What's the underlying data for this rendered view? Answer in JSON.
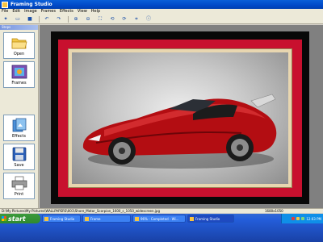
{
  "window": {
    "title": "Framing Studio"
  },
  "menu": [
    "File",
    "Edit",
    "Image",
    "Frames",
    "Effects",
    "View",
    "Help"
  ],
  "toolbar": {
    "buttons": [
      {
        "icon": "new-icon",
        "glyph": "✦"
      },
      {
        "icon": "folder-icon",
        "glyph": "▭"
      },
      {
        "icon": "save-icon",
        "glyph": "■"
      },
      {
        "icon": "undo-icon",
        "glyph": "↶"
      },
      {
        "icon": "redo-icon",
        "glyph": "↷"
      },
      {
        "icon": "zoom-in-icon",
        "glyph": "⊕"
      },
      {
        "icon": "zoom-out-icon",
        "glyph": "⊖"
      },
      {
        "icon": "fit-icon",
        "glyph": "⛶"
      },
      {
        "icon": "rotate-left-icon",
        "glyph": "⟲"
      },
      {
        "icon": "rotate-right-icon",
        "glyph": "⟳"
      },
      {
        "icon": "crop-icon",
        "glyph": "⌗"
      },
      {
        "icon": "info-icon",
        "glyph": "ⓘ"
      }
    ]
  },
  "sidebar": {
    "header": "Steps",
    "buttons": [
      {
        "label": "Open",
        "icon": "open-folder-icon"
      },
      {
        "label": "Frames",
        "icon": "frames-icon"
      },
      {
        "label": "Effects",
        "icon": "effects-icon"
      },
      {
        "label": "Save",
        "icon": "floppy-disk-icon"
      },
      {
        "label": "Print",
        "icon": "printer-icon"
      }
    ]
  },
  "status": {
    "path": "D:\\My Pictures\\My Pictures\\WALLPAPERS\\001\\Shore_Motor_Scorpion_1600_c_1050_widescreen.jpg",
    "dimensions": "1680x1050"
  },
  "taskbar": {
    "start_label": "start",
    "items": [
      {
        "label": "Framing Studio",
        "active": false
      },
      {
        "label": "Frame",
        "active": false
      },
      {
        "label": "96% - Completed - Wi...",
        "active": false
      },
      {
        "label": "Framing Studio",
        "active": true
      }
    ],
    "clock": "12:03 PM"
  },
  "colors": {
    "frame_outer": "#080808",
    "frame_mat": "#c8102e",
    "frame_inner": "#e8d6b0",
    "car_body": "#b30d12"
  }
}
